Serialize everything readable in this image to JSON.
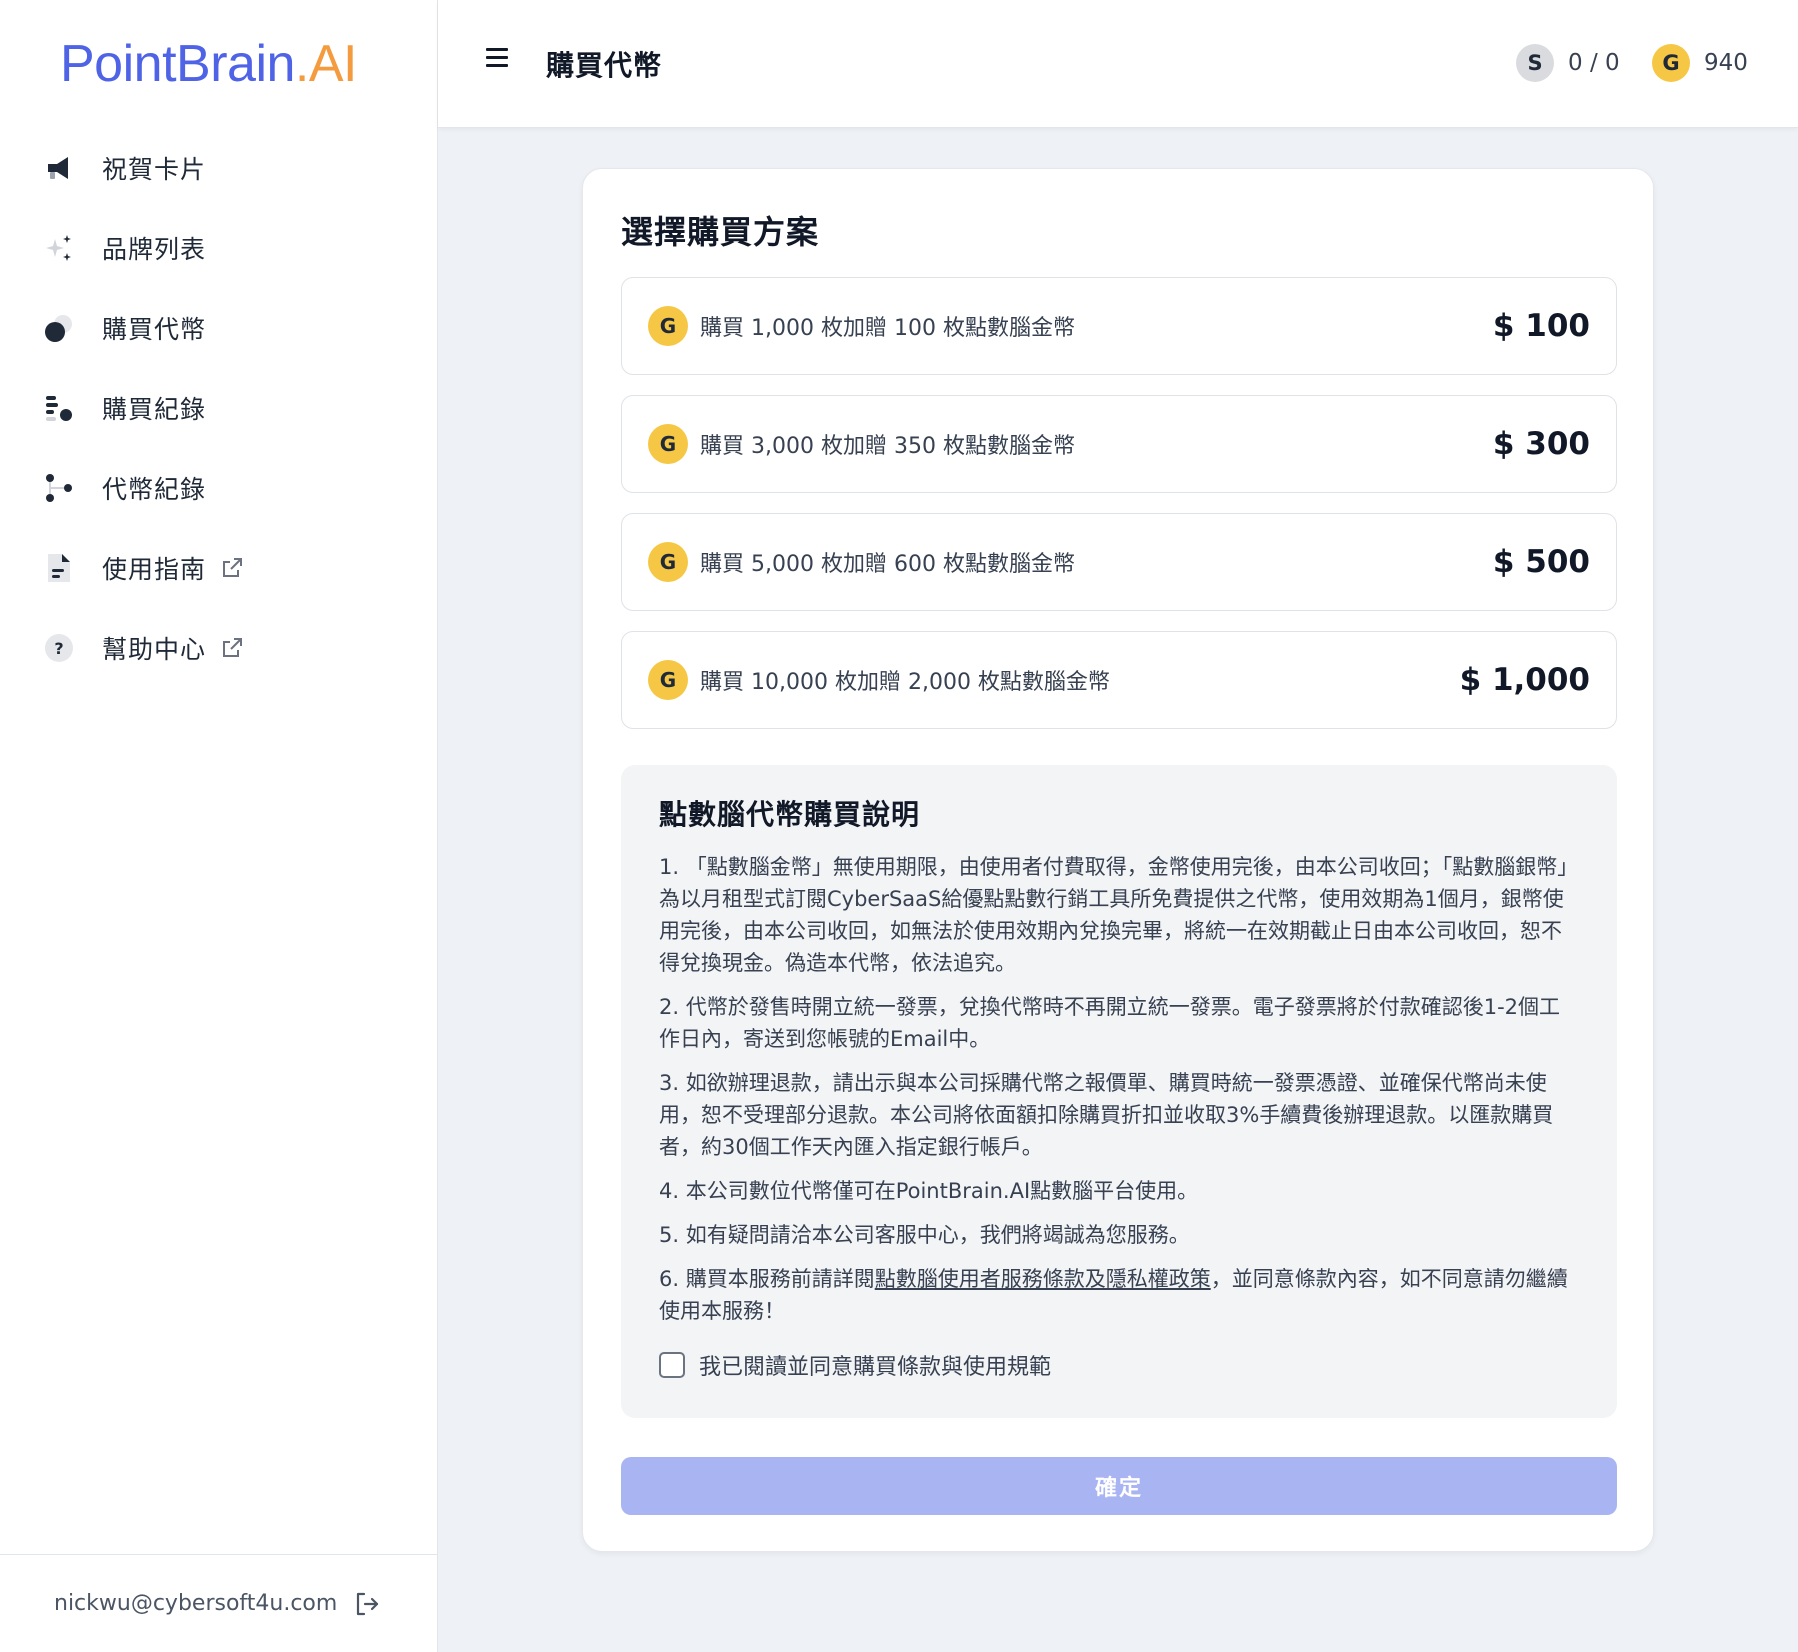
{
  "brand": {
    "logo_main": "PointBrain",
    "logo_suffix": ".AI"
  },
  "sidebar": {
    "items": [
      {
        "label": "祝賀卡片",
        "icon": "megaphone-icon",
        "external": false
      },
      {
        "label": "品牌列表",
        "icon": "sparkles-icon",
        "external": false
      },
      {
        "label": "購買代幣",
        "icon": "coins-icon",
        "external": false
      },
      {
        "label": "購買紀錄",
        "icon": "purchase-history-icon",
        "external": false
      },
      {
        "label": "代幣紀錄",
        "icon": "token-history-icon",
        "external": false
      },
      {
        "label": "使用指南",
        "icon": "document-icon",
        "external": true
      },
      {
        "label": "幫助中心",
        "icon": "help-icon",
        "external": true
      }
    ],
    "footer": {
      "email": "nickwu@cybersoft4u.com"
    }
  },
  "header": {
    "title": "購買代幣",
    "silver_balance": {
      "coin": "S",
      "value": "0 / 0"
    },
    "gold_balance": {
      "coin": "G",
      "value": "940"
    }
  },
  "purchase": {
    "title": "選擇購買方案",
    "plans": [
      {
        "coin": "G",
        "label": "購買 1,000 枚加贈 100 枚點數腦金幣",
        "price": "$ 100"
      },
      {
        "coin": "G",
        "label": "購買 3,000 枚加贈 350 枚點數腦金幣",
        "price": "$ 300"
      },
      {
        "coin": "G",
        "label": "購買 5,000 枚加贈 600 枚點數腦金幣",
        "price": "$ 500"
      },
      {
        "coin": "G",
        "label": "購買 10,000 枚加贈 2,000 枚點數腦金幣",
        "price": "$ 1,000"
      }
    ],
    "info": {
      "title": "點數腦代幣購買說明",
      "items": [
        "1. 「點數腦金幣」無使用期限，由使用者付費取得，金幣使用完後，由本公司收回；「點數腦銀幣」為以月租型式訂閱CyberSaaS給優點點數行銷工具所免費提供之代幣，使用效期為1個月，銀幣使用完後，由本公司收回，如無法於使用效期內兌換完畢，將統一在效期截止日由本公司收回，恕不得兌換現金。偽造本代幣，依法追究。",
        "2. 代幣於發售時開立統一發票，兌換代幣時不再開立統一發票。電子發票將於付款確認後1-2個工作日內，寄送到您帳號的Email中。",
        "3. 如欲辦理退款，請出示與本公司採購代幣之報價單、購買時統一發票憑證、並確保代幣尚未使用，恕不受理部分退款。本公司將依面額扣除購買折扣並收取3%手續費後辦理退款。以匯款購買者，約30個工作天內匯入指定銀行帳戶。",
        "4. 本公司數位代幣僅可在PointBrain.AI點數腦平台使用。",
        "5. 如有疑問請洽本公司客服中心，我們將竭誠為您服務。"
      ],
      "item6_prefix": "6. 購買本服務前請詳閱",
      "item6_link": "點數腦使用者服務條款及隱私權政策",
      "item6_suffix": "，並同意條款內容，如不同意請勿繼續使用本服務！",
      "agree_label": "我已閱讀並同意購買條款與使用規範",
      "agree_checked": false
    },
    "confirm_label": "確定",
    "confirm_color": "#a9b4f2"
  }
}
